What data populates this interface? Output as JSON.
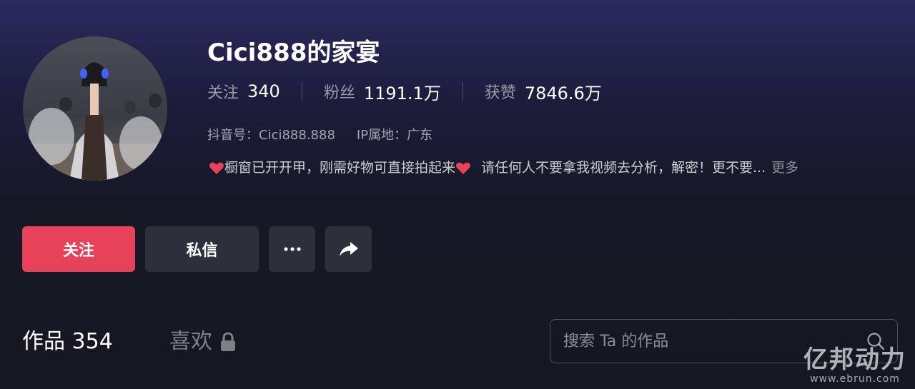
{
  "profile": {
    "name": "Cici888的家宴",
    "stats": [
      {
        "label": "关注",
        "value": "340"
      },
      {
        "label": "粉丝",
        "value": "1191.1万"
      },
      {
        "label": "获赞",
        "value": "7846.6万"
      }
    ],
    "douyin_id": "抖音号：Cici888.888",
    "ip_location": "IP属地：广东",
    "bio_part1": "橱窗已开开甲，刚需好物可直接拍起来",
    "bio_part2": "请任何人不要拿我视频去分析，解密！更不要...",
    "bio_more": "更多"
  },
  "actions": {
    "follow_label": "关注",
    "message_label": "私信",
    "more_icon": "ellipsis-icon",
    "share_icon": "share-arrow-icon"
  },
  "tabs": {
    "works_label": "作品 354",
    "likes_label": "喜欢",
    "likes_icon": "lock-icon"
  },
  "search": {
    "placeholder": "搜索 Ta 的作品",
    "icon": "search-icon"
  },
  "watermark": {
    "logo_text": "亿邦动力",
    "url": "www.ebrun.com"
  },
  "colors": {
    "follow_button": "#e8425a",
    "secondary_button": "#2d2f3a",
    "heart": "#e8425a"
  }
}
